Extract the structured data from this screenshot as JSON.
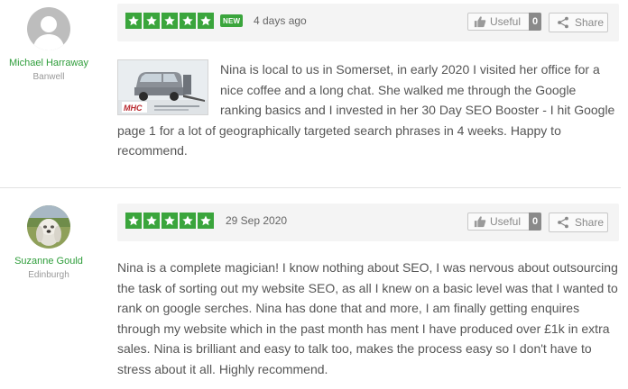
{
  "reviews": [
    {
      "author": {
        "name": "Michael Harraway",
        "location": "Banwell",
        "avatar": "default-avatar"
      },
      "rating": 5,
      "badge": "NEW",
      "date": "4 days ago",
      "useful": {
        "label": "Useful",
        "count": "0"
      },
      "share": {
        "label": "Share"
      },
      "photo": {
        "logo_text": "MHC"
      },
      "text": "Nina is local to us in Somerset, in early 2020 I visited her office for a nice coffee and a long chat. She walked me through the Google ranking basics and I invested in her 30 Day SEO Booster - I hit Google page 1 for a lot of geographically targeted search phrases in 4 weeks. Happy to recommend."
    },
    {
      "author": {
        "name": "Suzanne Gould",
        "location": "Edinburgh",
        "avatar": "dog-photo-avatar"
      },
      "rating": 5,
      "date": "29 Sep 2020",
      "useful": {
        "label": "Useful",
        "count": "0"
      },
      "share": {
        "label": "Share"
      },
      "text": "Nina is a complete magician! I know nothing about SEO, I was nervous about outsourcing the task of sorting out my website SEO, as all I knew on a basic level was that I wanted to rank on google serches. Nina has done that and more, I am finally getting enquires through my website which in the past month has ment I have produced over £1k in extra sales. Nina is brilliant and easy to talk too, makes the process easy so I don't have to stress about it all. Highly recommend."
    }
  ],
  "colors": {
    "star_green": "#3aa53c",
    "author_name_green": "#2e9d3a",
    "header_bg": "#f4f4f4",
    "count_bg": "#8a8a8a"
  }
}
